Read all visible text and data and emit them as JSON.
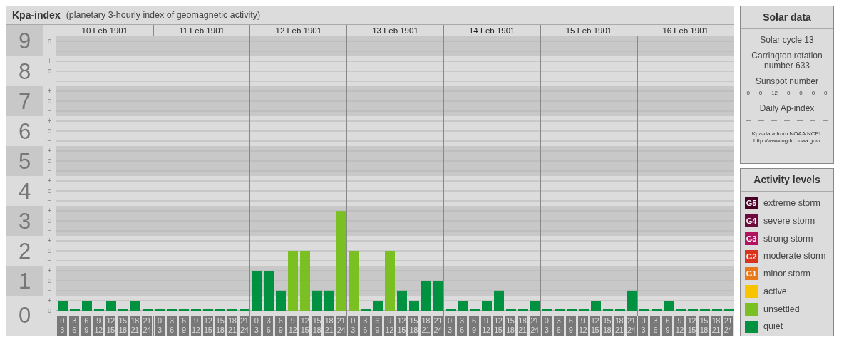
{
  "kp_panel": {
    "title": "Kpa-index",
    "subtitle": "(planetary 3-hourly index of geomagnetic activity)",
    "scale_marks": [
      [
        "o",
        "−"
      ],
      [
        "+",
        "o",
        "−"
      ],
      [
        "+",
        "o",
        "−"
      ],
      [
        "+",
        "o",
        "−"
      ],
      [
        "+",
        "o",
        "−"
      ],
      [
        "+",
        "o",
        "−"
      ],
      [
        "+",
        "o",
        "−"
      ],
      [
        "+",
        "o",
        "−"
      ],
      [
        "+",
        "o",
        "−"
      ],
      [
        "+",
        "o"
      ]
    ],
    "days": [
      {
        "date": "10 Feb 1901",
        "slots": [
          {
            "start": "0",
            "end": "3"
          },
          {
            "start": "3",
            "end": "6"
          },
          {
            "start": "6",
            "end": "9"
          },
          {
            "start": "9",
            "end": "12"
          },
          {
            "start": "12",
            "end": "15"
          },
          {
            "start": "15",
            "end": "18"
          },
          {
            "start": "18",
            "end": "21"
          },
          {
            "start": "21",
            "end": "24"
          }
        ]
      },
      {
        "date": "11 Feb 1901",
        "slots": [
          {
            "start": "0",
            "end": "3"
          },
          {
            "start": "3",
            "end": "6"
          },
          {
            "start": "6",
            "end": "9"
          },
          {
            "start": "9",
            "end": "12"
          },
          {
            "start": "12",
            "end": "15"
          },
          {
            "start": "15",
            "end": "18"
          },
          {
            "start": "18",
            "end": "21"
          },
          {
            "start": "21",
            "end": "24"
          }
        ]
      },
      {
        "date": "12 Feb 1901",
        "slots": [
          {
            "start": "0",
            "end": "3"
          },
          {
            "start": "3",
            "end": "6"
          },
          {
            "start": "6",
            "end": "9"
          },
          {
            "start": "9",
            "end": "12"
          },
          {
            "start": "12",
            "end": "15"
          },
          {
            "start": "15",
            "end": "18"
          },
          {
            "start": "18",
            "end": "21"
          },
          {
            "start": "21",
            "end": "24"
          }
        ]
      },
      {
        "date": "13 Feb 1901",
        "slots": [
          {
            "start": "0",
            "end": "3"
          },
          {
            "start": "3",
            "end": "6"
          },
          {
            "start": "6",
            "end": "9"
          },
          {
            "start": "9",
            "end": "12"
          },
          {
            "start": "12",
            "end": "15"
          },
          {
            "start": "15",
            "end": "18"
          },
          {
            "start": "18",
            "end": "21"
          },
          {
            "start": "21",
            "end": "24"
          }
        ]
      },
      {
        "date": "14 Feb 1901",
        "slots": [
          {
            "start": "0",
            "end": "3"
          },
          {
            "start": "3",
            "end": "6"
          },
          {
            "start": "6",
            "end": "9"
          },
          {
            "start": "9",
            "end": "12"
          },
          {
            "start": "12",
            "end": "15"
          },
          {
            "start": "15",
            "end": "18"
          },
          {
            "start": "18",
            "end": "21"
          },
          {
            "start": "21",
            "end": "24"
          }
        ]
      },
      {
        "date": "15 Feb 1901",
        "slots": [
          {
            "start": "0",
            "end": "3"
          },
          {
            "start": "3",
            "end": "6"
          },
          {
            "start": "6",
            "end": "9"
          },
          {
            "start": "9",
            "end": "12"
          },
          {
            "start": "12",
            "end": "15"
          },
          {
            "start": "15",
            "end": "18"
          },
          {
            "start": "18",
            "end": "21"
          },
          {
            "start": "21",
            "end": "24"
          }
        ]
      },
      {
        "date": "16 Feb 1901",
        "slots": [
          {
            "start": "0",
            "end": "3"
          },
          {
            "start": "3",
            "end": "6"
          },
          {
            "start": "6",
            "end": "9"
          },
          {
            "start": "9",
            "end": "12"
          },
          {
            "start": "12",
            "end": "15"
          },
          {
            "start": "15",
            "end": "18"
          },
          {
            "start": "18",
            "end": "21"
          },
          {
            "start": "21",
            "end": "24"
          }
        ]
      }
    ],
    "chart_data": {
      "type": "bar",
      "ylim": [
        0,
        9
      ],
      "grid": true,
      "yticks": [
        9,
        8,
        7,
        6,
        5,
        4,
        3,
        2,
        1,
        0
      ],
      "series": [
        {
          "color": "#009240",
          "values": [
            0.33,
            0,
            0.33,
            0,
            0.33,
            0,
            0.33,
            0,
            0,
            0,
            0,
            0,
            0,
            0,
            0,
            0,
            1.33,
            1.33,
            0.67,
            null,
            null,
            0.67,
            0.67,
            null,
            null,
            0,
            0.33,
            null,
            0.67,
            0.33,
            1,
            1,
            0,
            0.33,
            0,
            0.33,
            0.67,
            0,
            0,
            0.33,
            0,
            0,
            0,
            0,
            0.33,
            0,
            0,
            0.67,
            0,
            0,
            0.33,
            0,
            0,
            0,
            0,
            0
          ]
        },
        {
          "color": "#7ac022",
          "values": [
            null,
            null,
            null,
            null,
            null,
            null,
            null,
            null,
            null,
            null,
            null,
            null,
            null,
            null,
            null,
            null,
            null,
            null,
            null,
            2,
            2,
            null,
            null,
            3.33,
            2,
            null,
            null,
            2,
            null,
            null,
            null,
            null,
            null,
            null,
            null,
            null,
            null,
            null,
            null,
            null,
            null,
            null,
            null,
            null,
            null,
            null,
            null,
            null,
            null,
            null,
            null,
            null,
            null,
            null,
            null,
            null
          ]
        }
      ]
    }
  },
  "solar_panel": {
    "title": "Solar data",
    "cycle": "Solar cycle 13",
    "carrington": "Carrington rotation number 633",
    "sunspot_label": "Sunspot number",
    "sunspots": [
      "0",
      "0",
      "12",
      "0",
      "0",
      "0",
      "0"
    ],
    "ap_label": "Daily Ap-index",
    "ap_values": [
      "—",
      "—",
      "—",
      "—",
      "—",
      "—",
      "—"
    ],
    "source": "Kpa-data from NOAA NCEI:",
    "source_url": "http://www.ngdc.noaa.gov/"
  },
  "legend": {
    "title": "Activity levels",
    "items": [
      {
        "badge": "G5",
        "label": "extreme storm",
        "color": "#4a0126"
      },
      {
        "badge": "G4",
        "label": "severe storm",
        "color": "#6e0a3c"
      },
      {
        "badge": "G3",
        "label": "strong storm",
        "color": "#b3125e"
      },
      {
        "badge": "G2",
        "label": "moderate storm",
        "color": "#d9321d"
      },
      {
        "badge": "G1",
        "label": "minor storm",
        "color": "#e8781a"
      },
      {
        "label": "active",
        "color": "#f9c300"
      },
      {
        "label": "unsettled",
        "color": "#7ac022"
      },
      {
        "label": "quiet",
        "color": "#009240"
      }
    ]
  }
}
